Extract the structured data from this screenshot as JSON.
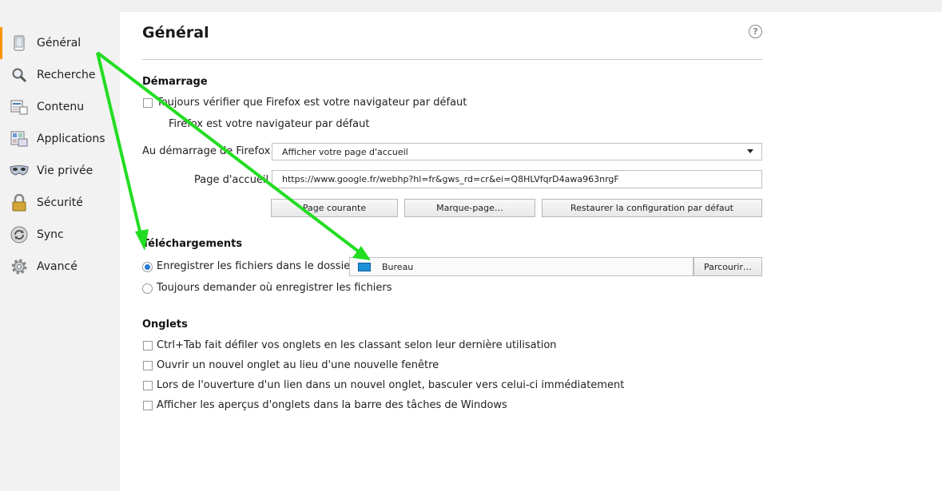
{
  "sidebar": {
    "items": [
      {
        "label": "Général",
        "icon": "general-icon",
        "active": true
      },
      {
        "label": "Recherche",
        "icon": "search-icon",
        "active": false
      },
      {
        "label": "Contenu",
        "icon": "content-icon",
        "active": false
      },
      {
        "label": "Applications",
        "icon": "applications-icon",
        "active": false
      },
      {
        "label": "Vie privée",
        "icon": "privacy-mask-icon",
        "active": false
      },
      {
        "label": "Sécurité",
        "icon": "padlock-icon",
        "active": false
      },
      {
        "label": "Sync",
        "icon": "sync-icon",
        "active": false
      },
      {
        "label": "Avancé",
        "icon": "gear-icon",
        "active": false
      }
    ]
  },
  "page": {
    "title": "Général",
    "help": "?"
  },
  "startup": {
    "title": "Démarrage",
    "default_check_label": "Toujours vérifier que Firefox est votre navigateur par défaut",
    "default_status": "Firefox est votre navigateur par défaut",
    "on_start_label": "Au démarrage de Firefox :",
    "on_start_value": "Afficher votre page d'accueil",
    "homepage_label": "Page d'accueil :",
    "homepage_value": "https://www.google.fr/webhp?hl=fr&gws_rd=cr&ei=Q8HLVfqrD4awa963nrgF",
    "btn_current": "Page courante",
    "btn_bookmark": "Marque-page…",
    "btn_restore": "Restaurer la configuration par défaut"
  },
  "downloads": {
    "title": "Téléchargements",
    "save_label": "Enregistrer les fichiers dans le dossier",
    "folder": "Bureau",
    "browse": "Parcourir…",
    "ask_label": "Toujours demander où enregistrer les fichiers"
  },
  "tabs": {
    "title": "Onglets",
    "options": [
      "Ctrl+Tab fait défiler vos onglets en les classant selon leur dernière utilisation",
      "Ouvrir un nouvel onglet au lieu d'une nouvelle fenêtre",
      "Lors de l'ouverture d'un lien dans un nouvel onglet, basculer vers celui-ci immédiatement",
      "Afficher les aperçus d'onglets dans la barre des tâches de Windows"
    ]
  },
  "colors": {
    "accent_active": "#ff9500",
    "annotation_arrow": "#22dd22",
    "radio_checked": "#2a7ad8"
  }
}
